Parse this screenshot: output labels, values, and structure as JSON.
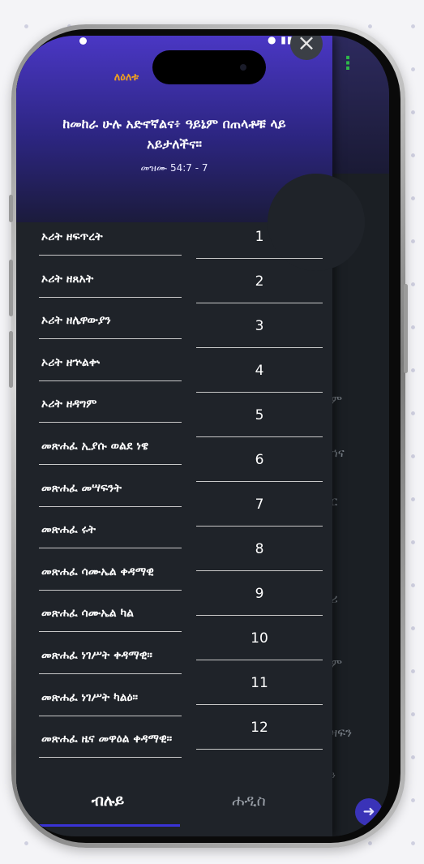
{
  "header": {
    "prayer_label": "ለዕለቱ",
    "verse": "ከመከራ ሁሉ አድኖኛልና፥ ዓይኔም በጠላቶቹ ላይ አይታለችና።",
    "reference": "መዝሙ 54:7 - 7"
  },
  "close_label": "×",
  "menu_dots": "⋮",
  "books": [
    {
      "name": "ኦሪት ዘፍጥረት"
    },
    {
      "name": "ኦሪት ዘጸአት"
    },
    {
      "name": "ኦሪት ዘሌዋውያን"
    },
    {
      "name": "ኦሪት ዘኍልቍ"
    },
    {
      "name": "ኦሪት ዘዳግም"
    },
    {
      "name": "መጽሐፈ ኢያሱ ወልደ ነዌ"
    },
    {
      "name": "መጽሐፈ መሣፍንት"
    },
    {
      "name": "መጽሐፈ ሩት"
    },
    {
      "name": "መጽሐፈ ሳሙኤል ቀዳማዊ"
    },
    {
      "name": "መጽሐፈ ሳሙኤል ካል"
    },
    {
      "name": "መጽሐፈ ነገሥት ቀዳማዊ።"
    },
    {
      "name": "መጽሐፈ ነገሥት ካልዕ።"
    },
    {
      "name": "መጽሐፈ ዜና መዋዕል ቀዳማዊ።"
    }
  ],
  "numbers": [
    "1",
    "2",
    "3",
    "4",
    "5",
    "6",
    "7",
    "8",
    "9",
    "10",
    "11",
    "12"
  ],
  "background_fragments": [
    "ም",
    "ም",
    "ኀና",
    "ር",
    "ሪ",
    "ም",
    "ዛፍን",
    "ን"
  ],
  "tabs": {
    "old": "ብሉይ",
    "new": "ሐዲስ"
  },
  "fab_icon": "➜",
  "colors": {
    "accent": "#3a33d6",
    "label": "#f0a020",
    "header_top": "#4a37c4"
  }
}
